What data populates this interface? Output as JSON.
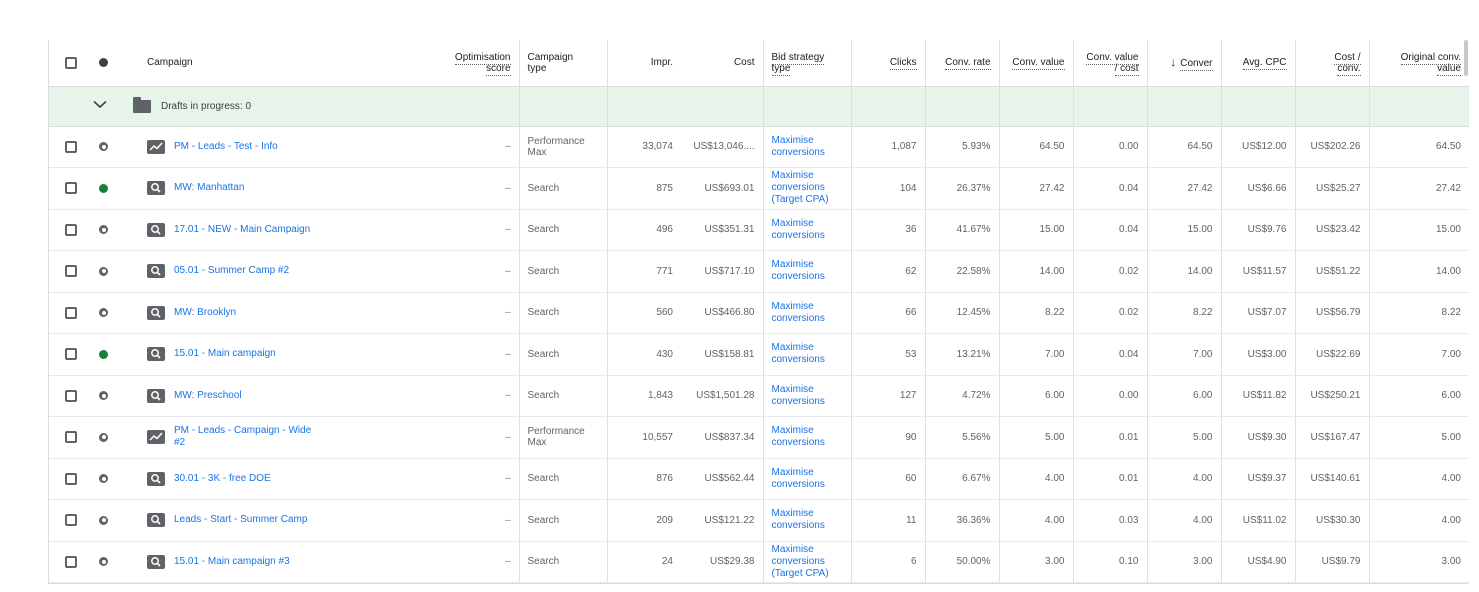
{
  "columns": {
    "campaign": "Campaign",
    "optimisation_score": [
      "Optimisation",
      "score"
    ],
    "campaign_type": [
      "Campaign",
      "type"
    ],
    "impr": "Impr.",
    "cost": "Cost",
    "bid_strategy_type": [
      "Bid strategy",
      "type"
    ],
    "clicks": "Clicks",
    "conv_rate": "Conv. rate",
    "conv_value": "Conv. value",
    "conv_value_cost": [
      "Conv. value",
      "/ cost"
    ],
    "conversions": "Conver",
    "avg_cpc": "Avg. CPC",
    "cost_conv": [
      "Cost /",
      "conv."
    ],
    "original_conv_value": [
      "Original conv.",
      "value"
    ]
  },
  "sort_indicator": "↓",
  "drafts_row": {
    "label": "Drafts in progress: 0"
  },
  "colors": {
    "link": "#1a73e8",
    "enabled": "#188038",
    "drafts_bg": "#e6f4ea"
  },
  "rows": [
    {
      "status": "paused",
      "type_icon": "performance-max-icon",
      "name": [
        "PM - Leads -  Test - Info"
      ],
      "opt": "–",
      "ctype": [
        "Performance",
        "Max"
      ],
      "impr": "33,074",
      "cost": "US$13,046....",
      "bid": [
        "Maximise",
        "conversions"
      ],
      "clicks": "1,087",
      "conv_rate": "5.93%",
      "conv_value": "64.50",
      "cvc": "0.00",
      "conversions": "64.50",
      "avg_cpc": "US$12.00",
      "cost_conv": "US$202.26",
      "orig": "64.50"
    },
    {
      "status": "enabled",
      "type_icon": "search-campaign-icon",
      "name": [
        "MW: Manhattan"
      ],
      "opt": "–",
      "ctype": [
        "Search"
      ],
      "impr": "875",
      "cost": "US$693.01",
      "bid": [
        "Maximise",
        "conversions",
        "(Target CPA)"
      ],
      "clicks": "104",
      "conv_rate": "26.37%",
      "conv_value": "27.42",
      "cvc": "0.04",
      "conversions": "27.42",
      "avg_cpc": "US$6.66",
      "cost_conv": "US$25.27",
      "orig": "27.42"
    },
    {
      "status": "paused",
      "type_icon": "search-campaign-icon",
      "name": [
        "17.01 - NEW - Main Campaign"
      ],
      "opt": "–",
      "ctype": [
        "Search"
      ],
      "impr": "496",
      "cost": "US$351.31",
      "bid": [
        "Maximise",
        "conversions"
      ],
      "clicks": "36",
      "conv_rate": "41.67%",
      "conv_value": "15.00",
      "cvc": "0.04",
      "conversions": "15.00",
      "avg_cpc": "US$9.76",
      "cost_conv": "US$23.42",
      "orig": "15.00"
    },
    {
      "status": "paused",
      "type_icon": "search-campaign-icon",
      "name": [
        "05.01 - Summer Camp #2"
      ],
      "opt": "–",
      "ctype": [
        "Search"
      ],
      "impr": "771",
      "cost": "US$717.10",
      "bid": [
        "Maximise",
        "conversions"
      ],
      "clicks": "62",
      "conv_rate": "22.58%",
      "conv_value": "14.00",
      "cvc": "0.02",
      "conversions": "14.00",
      "avg_cpc": "US$11.57",
      "cost_conv": "US$51.22",
      "orig": "14.00"
    },
    {
      "status": "paused",
      "type_icon": "search-campaign-icon",
      "name": [
        "MW: Brooklyn"
      ],
      "opt": "–",
      "ctype": [
        "Search"
      ],
      "impr": "560",
      "cost": "US$466.80",
      "bid": [
        "Maximise",
        "conversions"
      ],
      "clicks": "66",
      "conv_rate": "12.45%",
      "conv_value": "8.22",
      "cvc": "0.02",
      "conversions": "8.22",
      "avg_cpc": "US$7.07",
      "cost_conv": "US$56.79",
      "orig": "8.22"
    },
    {
      "status": "enabled",
      "type_icon": "search-campaign-icon",
      "name": [
        "15.01 - Main campaign"
      ],
      "opt": "–",
      "ctype": [
        "Search"
      ],
      "impr": "430",
      "cost": "US$158.81",
      "bid": [
        "Maximise",
        "conversions"
      ],
      "clicks": "53",
      "conv_rate": "13.21%",
      "conv_value": "7.00",
      "cvc": "0.04",
      "conversions": "7.00",
      "avg_cpc": "US$3.00",
      "cost_conv": "US$22.69",
      "orig": "7.00"
    },
    {
      "status": "paused",
      "type_icon": "search-campaign-icon",
      "name": [
        "MW: Preschool"
      ],
      "opt": "–",
      "ctype": [
        "Search"
      ],
      "impr": "1,843",
      "cost": "US$1,501.28",
      "bid": [
        "Maximise",
        "conversions"
      ],
      "clicks": "127",
      "conv_rate": "4.72%",
      "conv_value": "6.00",
      "cvc": "0.00",
      "conversions": "6.00",
      "avg_cpc": "US$11.82",
      "cost_conv": "US$250.21",
      "orig": "6.00"
    },
    {
      "status": "paused",
      "type_icon": "performance-max-icon",
      "name": [
        "PM - Leads - Campaign - Wide",
        "#2"
      ],
      "opt": "–",
      "ctype": [
        "Performance",
        "Max"
      ],
      "impr": "10,557",
      "cost": "US$837.34",
      "bid": [
        "Maximise",
        "conversions"
      ],
      "clicks": "90",
      "conv_rate": "5.56%",
      "conv_value": "5.00",
      "cvc": "0.01",
      "conversions": "5.00",
      "avg_cpc": "US$9.30",
      "cost_conv": "US$167.47",
      "orig": "5.00"
    },
    {
      "status": "paused",
      "type_icon": "search-campaign-icon",
      "name": [
        "30.01 - 3K - free DOE"
      ],
      "opt": "–",
      "ctype": [
        "Search"
      ],
      "impr": "876",
      "cost": "US$562.44",
      "bid": [
        "Maximise",
        "conversions"
      ],
      "clicks": "60",
      "conv_rate": "6.67%",
      "conv_value": "4.00",
      "cvc": "0.01",
      "conversions": "4.00",
      "avg_cpc": "US$9.37",
      "cost_conv": "US$140.61",
      "orig": "4.00"
    },
    {
      "status": "paused",
      "type_icon": "search-campaign-icon",
      "name": [
        "Leads - Start - Summer Camp"
      ],
      "opt": "–",
      "ctype": [
        "Search"
      ],
      "impr": "209",
      "cost": "US$121.22",
      "bid": [
        "Maximise",
        "conversions"
      ],
      "clicks": "11",
      "conv_rate": "36.36%",
      "conv_value": "4.00",
      "cvc": "0.03",
      "conversions": "4.00",
      "avg_cpc": "US$11.02",
      "cost_conv": "US$30.30",
      "orig": "4.00"
    },
    {
      "status": "paused",
      "type_icon": "search-campaign-icon",
      "name": [
        "15.01 - Main campaign #3"
      ],
      "opt": "–",
      "ctype": [
        "Search"
      ],
      "impr": "24",
      "cost": "US$29.38",
      "bid": [
        "Maximise",
        "conversions",
        "(Target CPA)"
      ],
      "clicks": "6",
      "conv_rate": "50.00%",
      "conv_value": "3.00",
      "cvc": "0.10",
      "conversions": "3.00",
      "avg_cpc": "US$4.90",
      "cost_conv": "US$9.79",
      "orig": "3.00"
    }
  ]
}
